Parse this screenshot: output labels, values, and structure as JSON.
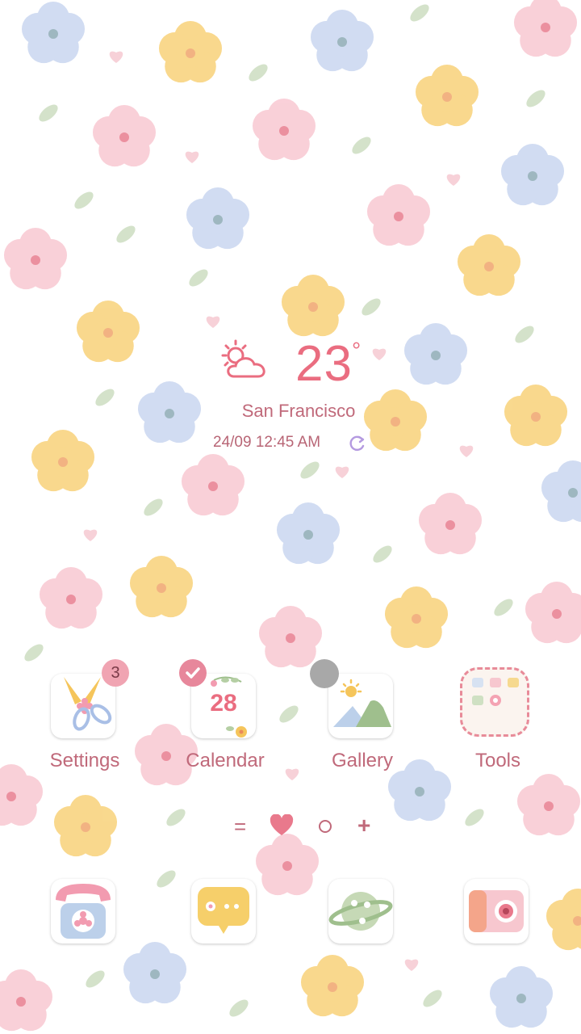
{
  "weather": {
    "temperature": "23",
    "degree_symbol": "°",
    "city": "San Francisco",
    "datetime": "24/09 12:45 AM",
    "icon": "sun-cloud-icon"
  },
  "apps": [
    {
      "label": "Settings",
      "icon": "scissors-icon",
      "badge": "3"
    },
    {
      "label": "Calendar",
      "icon": "calendar-icon",
      "calendar_day": "28",
      "badge_icon": "check-icon"
    },
    {
      "label": "Gallery",
      "icon": "landscape-icon",
      "badge_icon": "grey-dot"
    },
    {
      "label": "Tools",
      "icon": "tools-folder-icon"
    }
  ],
  "pager": {
    "menu_glyph": "=",
    "add_glyph": "+"
  },
  "dock": [
    {
      "name": "phone",
      "icon": "telephone-icon"
    },
    {
      "name": "messages",
      "icon": "chat-bubble-icon"
    },
    {
      "name": "internet",
      "icon": "planet-icon"
    },
    {
      "name": "camera",
      "icon": "camera-icon"
    }
  ],
  "colors": {
    "accent": "#ea6d80",
    "label": "#c0697a",
    "badge": "#f0a4b2",
    "check_badge": "#e7879b",
    "grey_badge": "#a8a8a8"
  }
}
